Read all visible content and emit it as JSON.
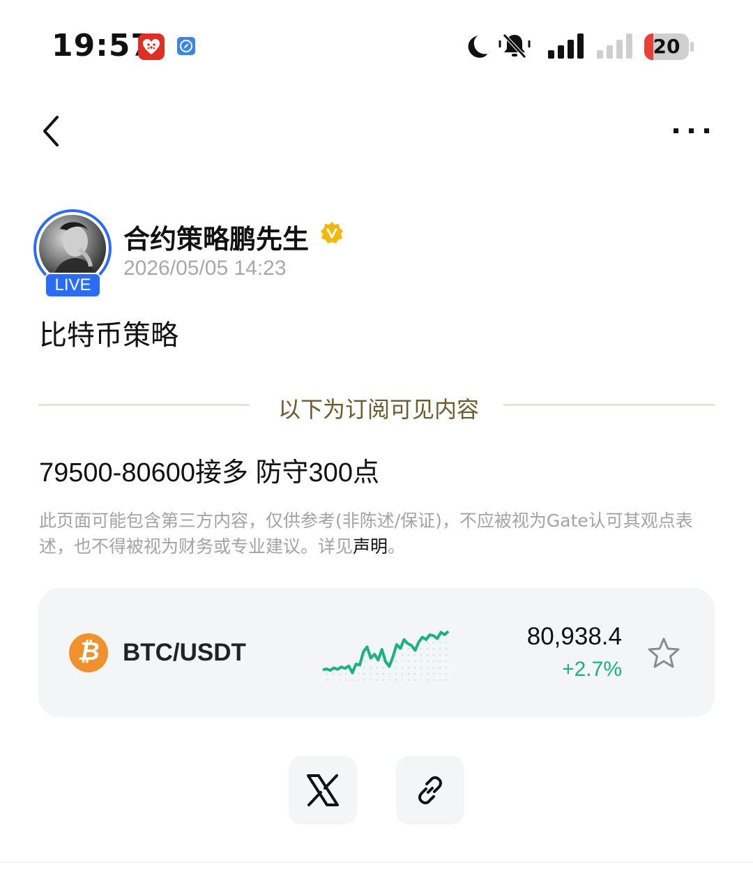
{
  "status_bar": {
    "time": "19:57",
    "battery_level": "20",
    "battery_fraction": 0.2
  },
  "nav": {
    "back_icon": "chevron-left-icon",
    "more_icon": "more-horizontal-icon"
  },
  "author": {
    "name": "合约策略鹏先生",
    "live_badge": "LIVE",
    "timestamp": "2026/05/05 14:23",
    "verified_color": "#f0b90b"
  },
  "post": {
    "title": "比特币策略",
    "subscriber_divider": "以下为订阅可见内容",
    "body": "79500-80600接多 防守300点",
    "disclaimer_text": "此页面可能包含第三方内容，仅供参考(非陈述/保证)，不应被视为Gate认可其观点表述，也不得被视为财务或专业建议。详见",
    "disclaimer_link": "声明",
    "disclaimer_end": "。"
  },
  "ticker": {
    "coin_symbol": "₿",
    "pair": "BTC/USDT",
    "price": "80,938.4",
    "change": "+2.7%",
    "change_color": "#1ab37a",
    "sparkline_trend": [
      0.18,
      0.2,
      0.17,
      0.22,
      0.19,
      0.24,
      0.21,
      0.26,
      0.12,
      0.3,
      0.28,
      0.55,
      0.65,
      0.42,
      0.5,
      0.38,
      0.6,
      0.35,
      0.25,
      0.45,
      0.7,
      0.62,
      0.8,
      0.72,
      0.68,
      0.58,
      0.75,
      0.85,
      0.8,
      0.9,
      0.88,
      0.82,
      0.95,
      0.9,
      0.97
    ],
    "star_icon": "star-outline-icon"
  },
  "share": {
    "x_icon": "x-logo-icon",
    "link_icon": "link-icon"
  },
  "colors": {
    "accent_blue": "#2a6cf6",
    "divider_text": "#6e5a2b",
    "sparkline": "#1ab37a"
  }
}
